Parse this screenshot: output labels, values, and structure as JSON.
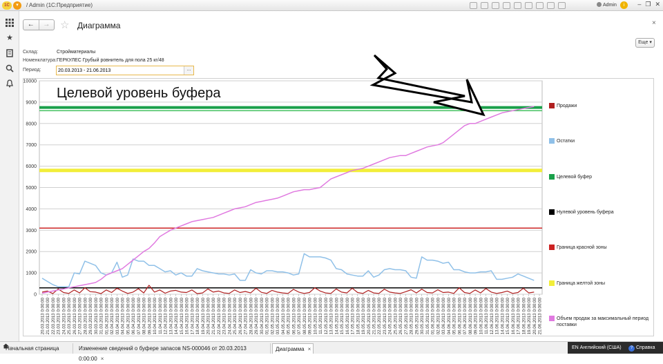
{
  "window": {
    "logo_text": "1С",
    "title": "/ Admin  (1С:Предприятие)",
    "user": "Admin"
  },
  "form": {
    "title": "Диаграмма",
    "more_label": "Еще",
    "fields": [
      {
        "label": "Склад:",
        "value": "Стройматериалы"
      },
      {
        "label": "Номенклатура:",
        "value": "ГЕРКУЛЕС Грубый ровнитель  для пола 25 кг/48"
      },
      {
        "label": "Период:",
        "value": "20.03.2013 - 21.06.2013"
      }
    ],
    "period_picker_label": "..."
  },
  "annotation": {
    "text": "Целевой уровень буфера"
  },
  "colors": {
    "sales": "#b02020",
    "stock": "#8fc0e8",
    "target_buffer": "#1aa04a",
    "zero_buffer": "#000000",
    "red_zone": "#cc2222",
    "yellow_zone": "#f2ee3a",
    "volume": "#e07ae0"
  },
  "chart_data": {
    "type": "line",
    "ylim": [
      0,
      10000
    ],
    "yticks": [
      0,
      1000,
      2000,
      3000,
      4000,
      5000,
      6000,
      7000,
      8000,
      9000,
      10000
    ],
    "x": [
      "20.03.2013 0:00:00",
      "21.03.2013 0:00:00",
      "22.03.2013 0:00:00",
      "23.03.2013 0:00:00",
      "24.03.2013 0:00:00",
      "25.03.2013 0:00:00",
      "26.03.2013 0:00:00",
      "27.03.2013 0:00:00",
      "28.03.2013 0:00:00",
      "29.03.2013 0:00:00",
      "30.03.2013 0:00:00",
      "31.03.2013 0:00:00",
      "01.04.2013 0:00:00",
      "02.04.2013 0:00:00",
      "03.04.2013 0:00:00",
      "04.04.2013 0:00:00",
      "05.04.2013 0:00:00",
      "06.04.2013 0:00:00",
      "07.04.2013 0:00:00",
      "08.04.2013 0:00:00",
      "09.04.2013 0:00:00",
      "10.04.2013 0:00:00",
      "11.04.2013 0:00:00",
      "12.04.2013 0:00:00",
      "13.04.2013 0:00:00",
      "14.04.2013 0:00:00",
      "15.04.2013 0:00:00",
      "16.04.2013 0:00:00",
      "17.04.2013 0:00:00",
      "18.04.2013 0:00:00",
      "19.04.2013 0:00:00",
      "20.04.2013 0:00:00",
      "21.04.2013 0:00:00",
      "22.04.2013 0:00:00",
      "23.04.2013 0:00:00",
      "24.04.2013 0:00:00",
      "25.04.2013 0:00:00",
      "26.04.2013 0:00:00",
      "27.04.2013 0:00:00",
      "28.04.2013 0:00:00",
      "29.04.2013 0:00:00",
      "30.04.2013 0:00:00",
      "01.05.2013 0:00:00",
      "02.05.2013 0:00:00",
      "03.05.2013 0:00:00",
      "04.05.2013 0:00:00",
      "05.05.2013 0:00:00",
      "06.05.2013 0:00:00",
      "07.05.2013 0:00:00",
      "08.05.2013 0:00:00",
      "09.05.2013 0:00:00",
      "10.05.2013 0:00:00",
      "11.05.2013 0:00:00",
      "12.05.2013 0:00:00",
      "13.05.2013 0:00:00",
      "14.05.2013 0:00:00",
      "15.05.2013 0:00:00",
      "16.05.2013 0:00:00",
      "17.05.2013 0:00:00",
      "18.05.2013 0:00:00",
      "19.05.2013 0:00:00",
      "20.05.2013 0:00:00",
      "21.05.2013 0:00:00",
      "22.05.2013 0:00:00",
      "23.05.2013 0:00:00",
      "24.05.2013 0:00:00",
      "25.05.2013 0:00:00",
      "26.05.2013 0:00:00",
      "27.05.2013 0:00:00",
      "28.05.2013 0:00:00",
      "29.05.2013 0:00:00",
      "30.05.2013 0:00:00",
      "31.05.2013 0:00:00",
      "01.06.2013 0:00:00",
      "02.06.2013 0:00:00",
      "03.06.2013 0:00:00",
      "04.06.2013 0:00:00",
      "05.06.2013 0:00:00",
      "06.06.2013 0:00:00",
      "07.06.2013 0:00:00",
      "08.06.2013 0:00:00",
      "09.06.2013 0:00:00",
      "10.06.2013 0:00:00",
      "11.06.2013 0:00:00",
      "12.06.2013 0:00:00",
      "13.06.2013 0:00:00",
      "14.06.2013 0:00:00",
      "15.06.2013 0:00:00",
      "16.06.2013 0:00:00",
      "17.06.2013 0:00:00",
      "18.06.2013 0:00:00",
      "19.06.2013 0:00:00",
      "20.06.2013 0:00:00",
      "21.06.2013 0:00:00"
    ],
    "series": [
      {
        "name": "Продажи",
        "type": "line",
        "values": [
          100,
          150,
          30,
          250,
          80,
          40,
          200,
          60,
          300,
          120,
          100,
          30,
          200,
          80,
          280,
          150,
          40,
          100,
          260,
          60,
          420,
          100,
          200,
          50,
          150,
          180,
          100,
          80,
          200,
          30,
          60,
          250,
          100,
          150,
          60,
          40,
          200,
          80,
          130,
          60,
          280,
          90,
          40,
          180,
          100,
          60,
          40,
          230,
          100,
          40,
          80,
          300,
          150,
          60,
          40,
          250,
          100,
          60,
          280,
          80,
          40,
          180,
          60,
          40,
          240,
          100,
          60,
          40,
          120,
          210,
          60,
          240,
          80,
          60,
          210,
          80,
          100,
          40,
          300,
          80,
          40,
          200,
          60,
          270,
          100,
          40,
          80,
          150,
          40,
          80,
          280,
          60,
          100
        ]
      },
      {
        "name": "Остатки",
        "type": "line",
        "values": [
          750,
          600,
          450,
          350,
          350,
          350,
          1000,
          950,
          1550,
          1450,
          1350,
          1000,
          900,
          1000,
          1500,
          800,
          900,
          1650,
          1550,
          1550,
          1350,
          1350,
          1200,
          1050,
          1100,
          900,
          1000,
          850,
          850,
          1200,
          1100,
          1050,
          1000,
          950,
          950,
          900,
          950,
          650,
          650,
          1150,
          1000,
          950,
          1100,
          1100,
          1050,
          1050,
          1000,
          900,
          950,
          1900,
          1750,
          1750,
          1750,
          1700,
          1600,
          1200,
          1150,
          950,
          900,
          850,
          850,
          1100,
          800,
          900,
          1150,
          1200,
          1150,
          1150,
          1100,
          800,
          750,
          1750,
          1600,
          1600,
          1550,
          1450,
          1500,
          1150,
          1150,
          1050,
          1000,
          1000,
          1050,
          1050,
          1100,
          700,
          700,
          750,
          800,
          950,
          850,
          750,
          650
        ]
      },
      {
        "name": "Целевой буфер",
        "type": "hline",
        "values": [
          8750
        ],
        "secondary": [
          8600
        ]
      },
      {
        "name": "Нулевой уровень буфера",
        "type": "hline",
        "values": [
          300
        ]
      },
      {
        "name": "Граница красной зоны",
        "type": "hline",
        "values": [
          3100
        ]
      },
      {
        "name": "Граница желтой зоны",
        "type": "hline",
        "values": [
          5800
        ]
      },
      {
        "name": "Объем продаж за максимальный период поставки",
        "type": "line",
        "values": [
          50,
          100,
          150,
          200,
          250,
          300,
          350,
          400,
          450,
          500,
          550,
          700,
          900,
          1000,
          1100,
          1200,
          1400,
          1600,
          1800,
          2000,
          2150,
          2400,
          2700,
          2850,
          3000,
          3100,
          3200,
          3300,
          3400,
          3450,
          3500,
          3550,
          3600,
          3700,
          3800,
          3900,
          4000,
          4050,
          4100,
          4200,
          4300,
          4350,
          4400,
          4450,
          4500,
          4600,
          4700,
          4800,
          4850,
          4900,
          4900,
          4950,
          5000,
          5200,
          5400,
          5500,
          5600,
          5700,
          5800,
          5850,
          5900,
          6000,
          6100,
          6200,
          6300,
          6400,
          6450,
          6500,
          6500,
          6600,
          6700,
          6800,
          6900,
          6950,
          7000,
          7100,
          7300,
          7500,
          7700,
          7900,
          8000,
          8000,
          8100,
          8200,
          8300,
          8400,
          8500,
          8550,
          8600,
          8650,
          8700,
          8750,
          8800
        ]
      }
    ],
    "legend_position": "right",
    "grid": true
  },
  "taskbar": {
    "tabs": [
      {
        "label": "Начальная страница"
      },
      {
        "label": "Изменение сведений о буфере запасов NS-000046 от 20.03.2013 0:00:00"
      },
      {
        "label": "Диаграмма"
      }
    ],
    "close_glyph": "×",
    "language": "EN Английский (США)",
    "help": "Справка"
  },
  "icons": [
    "apps-grid-icon",
    "favorites-star-icon",
    "history-icon",
    "search-icon",
    "notifications-bell-icon",
    "back-arrow-icon",
    "forward-arrow-icon",
    "home-icon",
    "close-icon",
    "help-icon"
  ]
}
